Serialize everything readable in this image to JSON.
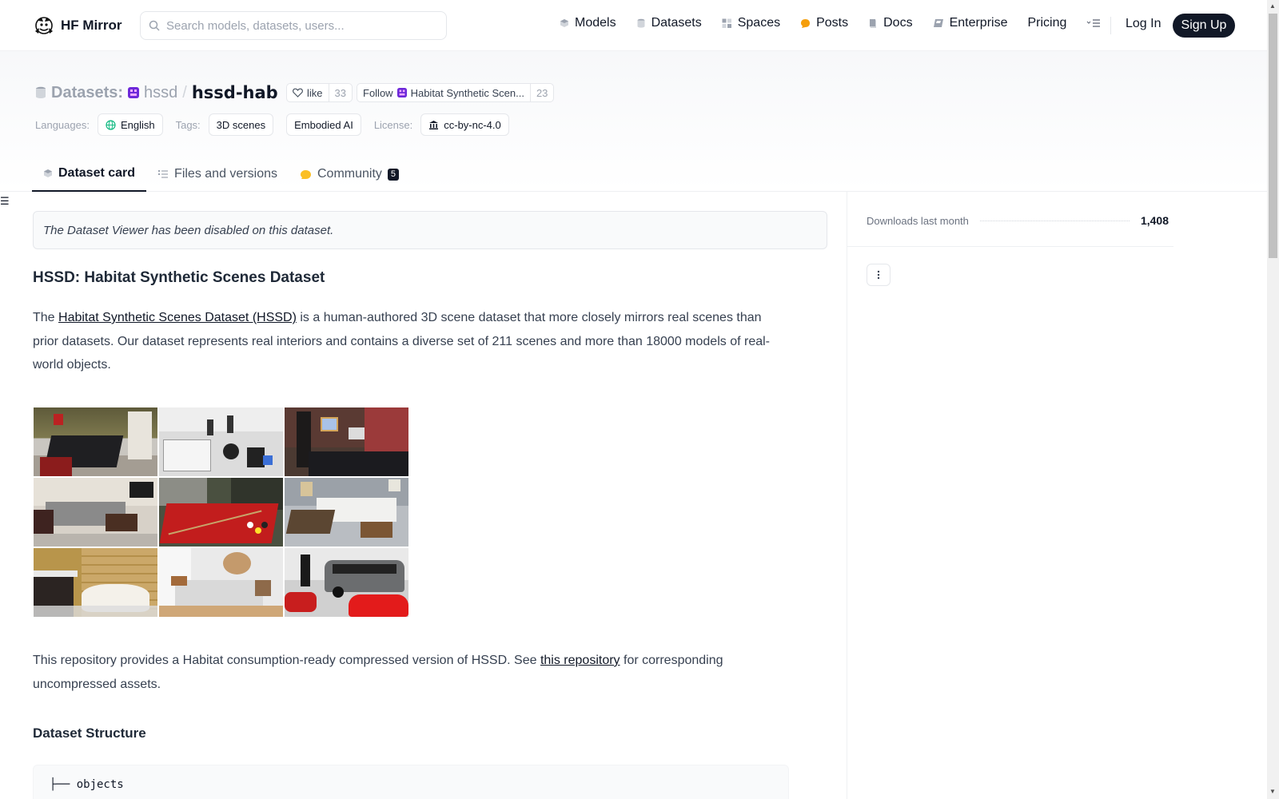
{
  "nav": {
    "brand": "HF Mirror",
    "search_placeholder": "Search models, datasets, users...",
    "links": [
      {
        "label": "Models",
        "icon": "cube-icon"
      },
      {
        "label": "Datasets",
        "icon": "database-icon"
      },
      {
        "label": "Spaces",
        "icon": "grid-icon"
      },
      {
        "label": "Posts",
        "icon": "speech-bubble-icon"
      },
      {
        "label": "Docs",
        "icon": "book-icon"
      },
      {
        "label": "Enterprise",
        "icon": "enterprise-icon"
      },
      {
        "label": "Pricing",
        "icon": ""
      }
    ],
    "login": "Log In",
    "signup": "Sign Up"
  },
  "repo": {
    "prefix": "Datasets:",
    "org": "hssd",
    "slash": "/",
    "name": "hssd-hab",
    "like_label": "like",
    "like_count": "33",
    "follow_label": "Follow",
    "follow_org": "Habitat Synthetic Scen...",
    "follow_count": "23"
  },
  "meta": {
    "languages_label": "Languages:",
    "language": "English",
    "tags_label": "Tags:",
    "tags": [
      "3D scenes",
      "Embodied AI"
    ],
    "license_label": "License:",
    "license": "cc-by-nc-4.0"
  },
  "tabs": [
    {
      "label": "Dataset card",
      "icon": "cube-icon",
      "active": true
    },
    {
      "label": "Files and versions",
      "icon": "files-icon",
      "active": false
    },
    {
      "label": "Community",
      "icon": "community-icon",
      "active": false,
      "badge": "5"
    }
  ],
  "content": {
    "viewer_notice": "The Dataset Viewer has been disabled on this dataset.",
    "title": "HSSD: Habitat Synthetic Scenes Dataset",
    "intro_before_link": "The ",
    "intro_link": "Habitat Synthetic Scenes Dataset (HSSD)",
    "intro_after_link": " is a human-authored 3D scene dataset that more closely mirrors real scenes than prior datasets. Our dataset represents real interiors and contains a diverse set of 211 scenes and more than 18000 models of real-world objects.",
    "repo_before_link": "This repository provides a Habitat consumption-ready compressed version of HSSD. See ",
    "repo_link": "this repository",
    "repo_after_link": " for corresponding uncompressed assets.",
    "structure_heading": "Dataset Structure",
    "code_line": "├── objects"
  },
  "sidebar": {
    "downloads_label": "Downloads last month",
    "downloads_value": "1,408"
  }
}
